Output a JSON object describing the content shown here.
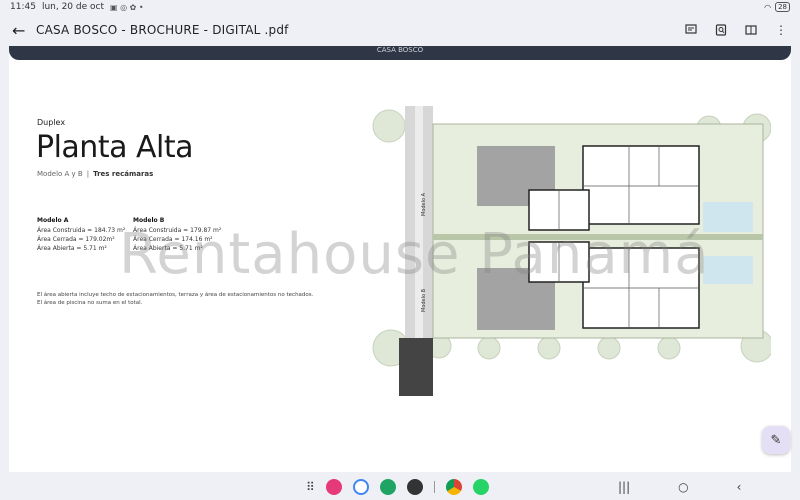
{
  "status_bar": {
    "time": "11:45",
    "date": "lun, 20 de oct",
    "battery": "28"
  },
  "app_bar": {
    "back_icon": "arrow-left-icon",
    "title": "CASA BOSCO - BROCHURE - DIGITAL .pdf"
  },
  "document": {
    "band_text": "CASA BOSCO",
    "subtitle": "Duplex",
    "heading": "Planta Alta",
    "model_text": "Modelo A y B",
    "separator": "|",
    "rooms": "Tres recámaras",
    "model_a": {
      "title": "Modelo A",
      "lines": [
        "Área Construida = 184.73 m²",
        "Área Cerrada = 179.02m²",
        "Área Abierta = 5.71  m²"
      ]
    },
    "model_b": {
      "title": "Modelo B",
      "lines": [
        "Área Construida = 179.87 m²",
        "Área Cerrada = 174.16 m²",
        "Área Abierta = 5.71  m²"
      ]
    },
    "notes": [
      "El área abierta incluye techo de estacionamientos, terraza y área de estacionamientos no techados.",
      "El área de piscina no suma en el total."
    ],
    "plan_labels": {
      "a": "Modelo A",
      "b": "Modelo B"
    },
    "watermark": "Rentahouse Panamá"
  }
}
